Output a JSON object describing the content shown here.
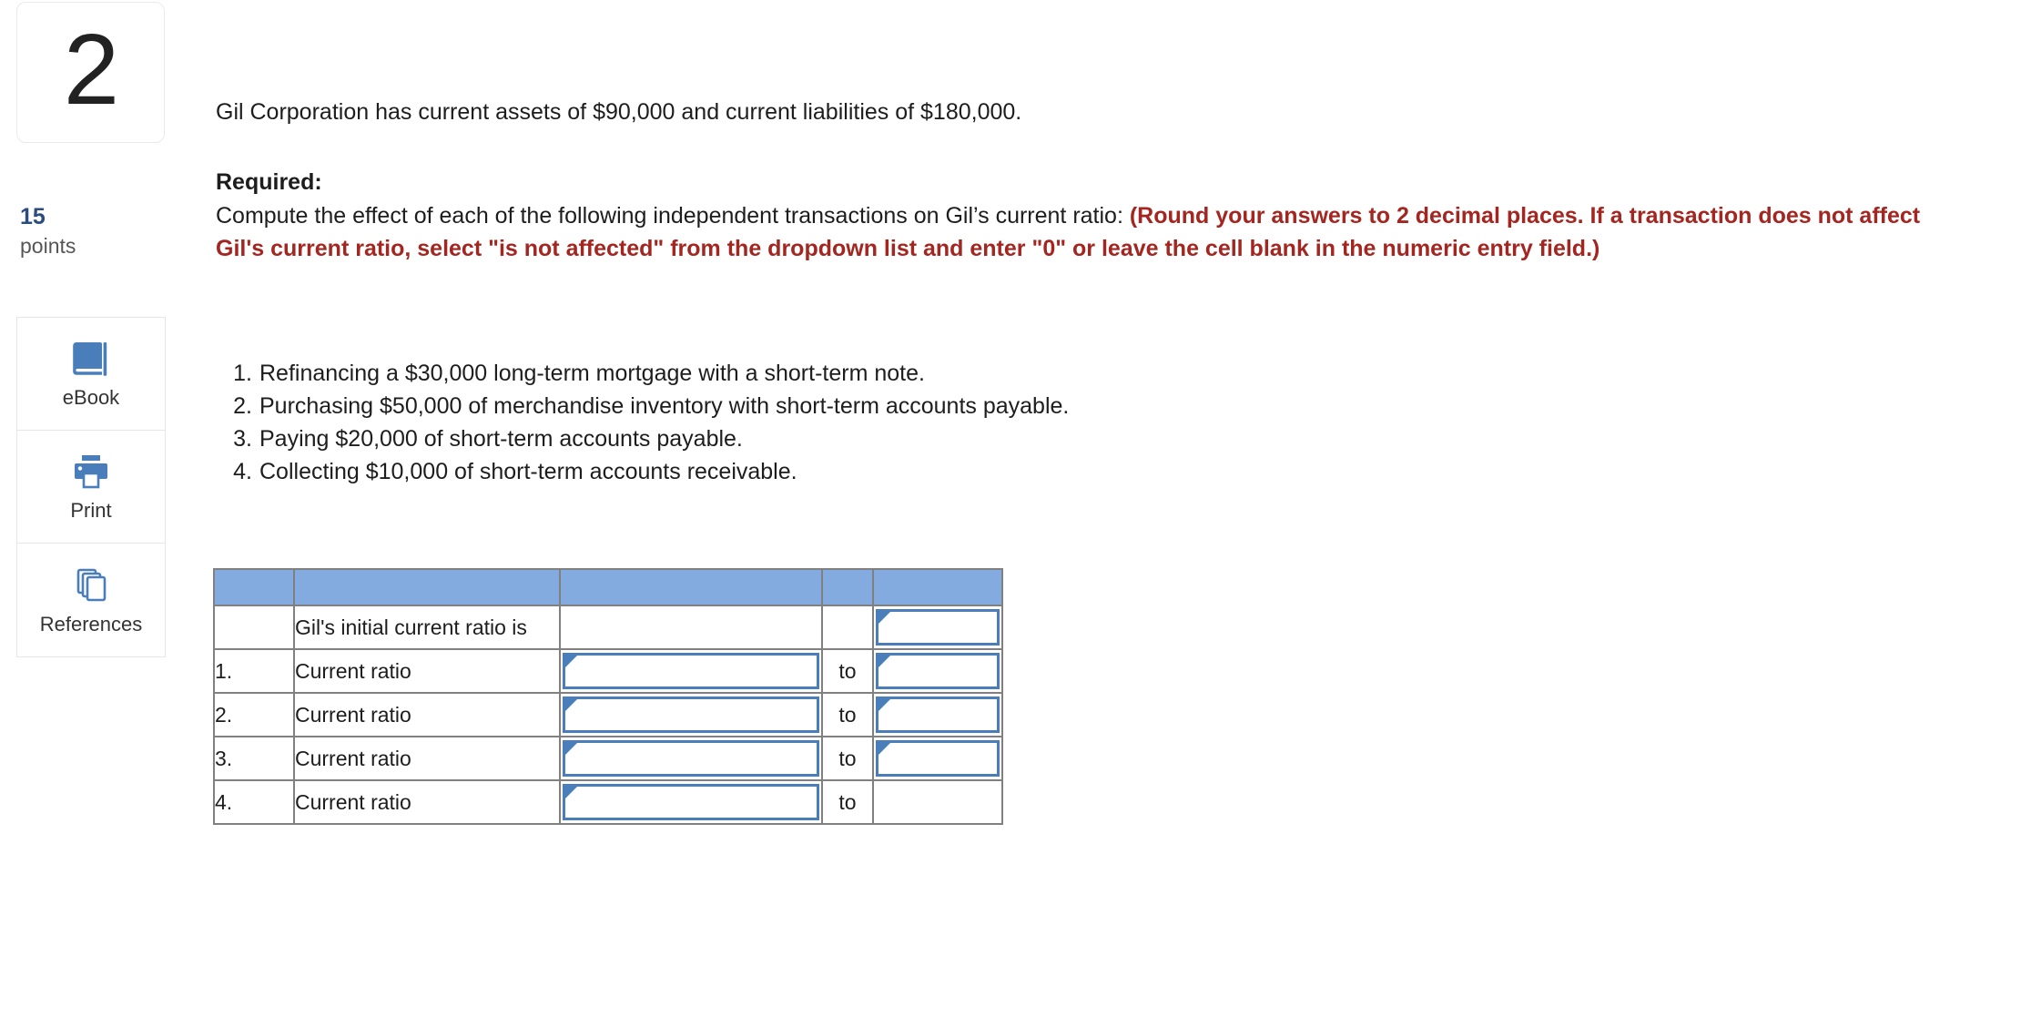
{
  "sidebar": {
    "question_number": "2",
    "points_value": "15",
    "points_label": "points",
    "tools": [
      {
        "id": "ebook",
        "label": "eBook",
        "icon": "book-icon"
      },
      {
        "id": "print",
        "label": "Print",
        "icon": "printer-icon"
      },
      {
        "id": "references",
        "label": "References",
        "icon": "pages-stack-icon"
      }
    ]
  },
  "question": {
    "stem": "Gil Corporation has current assets of $90,000 and current liabilities of $180,000.",
    "required_label": "Required:",
    "required_lead": "Compute the effect of each of the following independent transactions on Gil’s current ratio:",
    "required_red": "(Round your answers to 2 decimal places. If a transaction does not affect Gil's current ratio, select \"is not affected\" from the dropdown list and enter \"0\" or leave the cell blank in the numeric entry field.)",
    "transactions": [
      "Refinancing a $30,000 long-term mortgage with a short-term note.",
      "Purchasing $50,000 of merchandise inventory with short-term accounts payable.",
      "Paying $20,000 of short-term accounts payable.",
      "Collecting $10,000 of short-term accounts receivable."
    ]
  },
  "answer_table": {
    "header": {
      "c1": "",
      "c2": "",
      "c3": "",
      "c4": "",
      "c5": ""
    },
    "rows": [
      {
        "index": "",
        "label": "Gil's initial current ratio is",
        "entry": {
          "type": "none",
          "value": ""
        },
        "to": "",
        "last": {
          "type": "dropdown",
          "value": ""
        }
      },
      {
        "index": "1.",
        "label": "Current ratio",
        "entry": {
          "type": "dropdown",
          "value": ""
        },
        "to": "to",
        "last": {
          "type": "dropdown",
          "value": ""
        }
      },
      {
        "index": "2.",
        "label": "Current ratio",
        "entry": {
          "type": "dropdown",
          "value": ""
        },
        "to": "to",
        "last": {
          "type": "dropdown",
          "value": ""
        }
      },
      {
        "index": "3.",
        "label": "Current ratio",
        "entry": {
          "type": "dropdown",
          "value": ""
        },
        "to": "to",
        "last": {
          "type": "dropdown",
          "value": ""
        }
      },
      {
        "index": "4.",
        "label": "Current ratio",
        "entry": {
          "type": "dropdown",
          "value": ""
        },
        "to": "to",
        "last": {
          "type": "none",
          "value": ""
        }
      }
    ]
  },
  "colors": {
    "header_blue": "#83abe0",
    "field_blue": "#4a7ebb",
    "red_instruction": "#a32620",
    "points_blue": "#2b4c7e",
    "icon_blue": "#4a7ebb",
    "table_border": "#808080"
  }
}
